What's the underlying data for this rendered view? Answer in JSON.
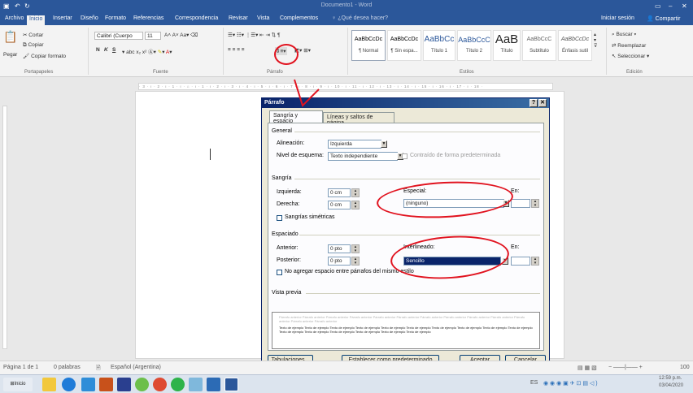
{
  "window": {
    "title": "Documento1 - Word"
  },
  "ribbon_tabs": [
    "Archivo",
    "Inicio",
    "Insertar",
    "Diseño",
    "Formato",
    "Referencias",
    "Correspondencia",
    "Revisar",
    "Vista",
    "Complementos"
  ],
  "tell_me": "¿Qué desea hacer?",
  "account": {
    "signin": "Iniciar sesión",
    "share": "Compartir"
  },
  "clipboard": {
    "paste": "Pegar",
    "cut": "Cortar",
    "copy": "Copiar",
    "format_painter": "Copiar formato",
    "label": "Portapapeles"
  },
  "font": {
    "name": "Calibri (Cuerpo",
    "size": "11",
    "bold": "N",
    "italic": "K",
    "underline": "S",
    "label": "Fuente"
  },
  "paragraph": {
    "label": "Párrafo"
  },
  "styles": {
    "items": [
      {
        "preview": "AaBbCcDc",
        "name": "¶ Normal"
      },
      {
        "preview": "AaBbCcDc",
        "name": "¶ Sin espa..."
      },
      {
        "preview": "AaBbCc",
        "name": "Título 1"
      },
      {
        "preview": "AaBbCcC",
        "name": "Título 2"
      },
      {
        "preview": "AaB",
        "name": "Título"
      },
      {
        "preview": "AaBbCcC",
        "name": "Subtítulo"
      },
      {
        "preview": "AaBbCcDc",
        "name": "Énfasis sutil"
      }
    ],
    "label": "Estilos"
  },
  "editing": {
    "find": "Buscar",
    "replace": "Reemplazar",
    "select": "Seleccionar",
    "label": "Edición"
  },
  "dialog": {
    "title": "Párrafo",
    "tabs": [
      "Sangría y espacio",
      "Líneas y saltos de página"
    ],
    "general": {
      "section": "General",
      "alignment_label": "Alineación:",
      "alignment": "Izquierda",
      "outline_label": "Nivel de esquema:",
      "outline": "Texto independiente",
      "collapsed": "Contraído de forma predeterminada"
    },
    "indent": {
      "section": "Sangría",
      "left_label": "Izquierda:",
      "left": "0 cm",
      "right_label": "Derecha:",
      "right": "0 cm",
      "special_label": "Especial:",
      "special": "(ninguno)",
      "by_label": "En:",
      "mirror": "Sangrías simétricas"
    },
    "spacing": {
      "section": "Espaciado",
      "before_label": "Anterior:",
      "before": "0 pto",
      "after_label": "Posterior:",
      "after": "0 pto",
      "line_label": "Interlineado:",
      "line": "Sencillo",
      "at_label": "En:",
      "no_space": "No agregar espacio entre párrafos del mismo estilo"
    },
    "preview": {
      "section": "Vista previa",
      "before_text": "Párrafo anterior Párrafo anterior Párrafo anterior Párrafo anterior Párrafo anterior Párrafo anterior Párrafo anterior Párrafo anterior Párrafo anterior Párrafo anterior Párrafo anterior Párrafo anterior Párrafo anterior",
      "sample_text": "Texto de ejemplo Texto de ejemplo Texto de ejemplo Texto de ejemplo Texto de ejemplo Texto de ejemplo Texto de ejemplo Texto de ejemplo Texto de ejemplo Texto de ejemplo Texto de ejemplo Texto de ejemplo Texto de ejemplo Texto de ejemplo Texto de ejemplo Texto de ejemplo"
    },
    "buttons": {
      "tabs": "Tabulaciones...",
      "default": "Establecer como predeterminado",
      "ok": "Aceptar",
      "cancel": "Cancelar"
    }
  },
  "status": {
    "page": "Página 1 de 1",
    "words": "0 palabras",
    "lang": "Español (Argentina)",
    "zoom": "100"
  },
  "taskbar": {
    "start": "Inicio",
    "lang": "ES",
    "time": "12:59 p.m.",
    "date": "03/04/2020"
  }
}
